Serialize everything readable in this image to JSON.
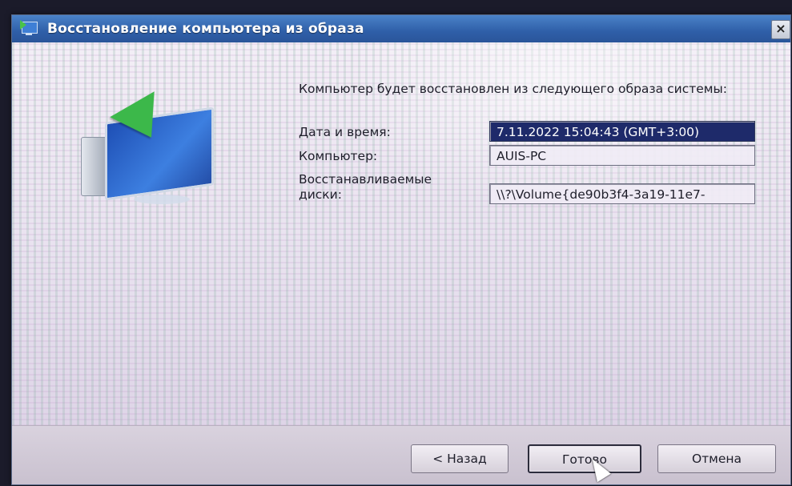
{
  "window": {
    "title": "Восстановление компьютера из образа",
    "close_label": "×"
  },
  "intro_text": "Компьютер будет восстановлен из следующего образа системы:",
  "fields": {
    "datetime": {
      "label": "Дата и время:",
      "value": "7.11.2022 15:04:43 (GMT+3:00)"
    },
    "computer": {
      "label": "Компьютер:",
      "value": "AUIS-PC"
    },
    "disks": {
      "label_line1": "Восстанавливаемые",
      "label_line2": "диски:",
      "value": "\\\\?\\Volume{de90b3f4-3a19-11e7-"
    }
  },
  "buttons": {
    "back": "< Назад",
    "finish": "Готово",
    "cancel": "Отмена"
  },
  "icons": {
    "window_icon": "system-restore-icon",
    "hero_icon": "computer-restore-icon",
    "cursor": "mouse-pointer-icon"
  },
  "colors": {
    "titlebar": "#2f5fa8",
    "selected_field": "#1e2a6a"
  }
}
